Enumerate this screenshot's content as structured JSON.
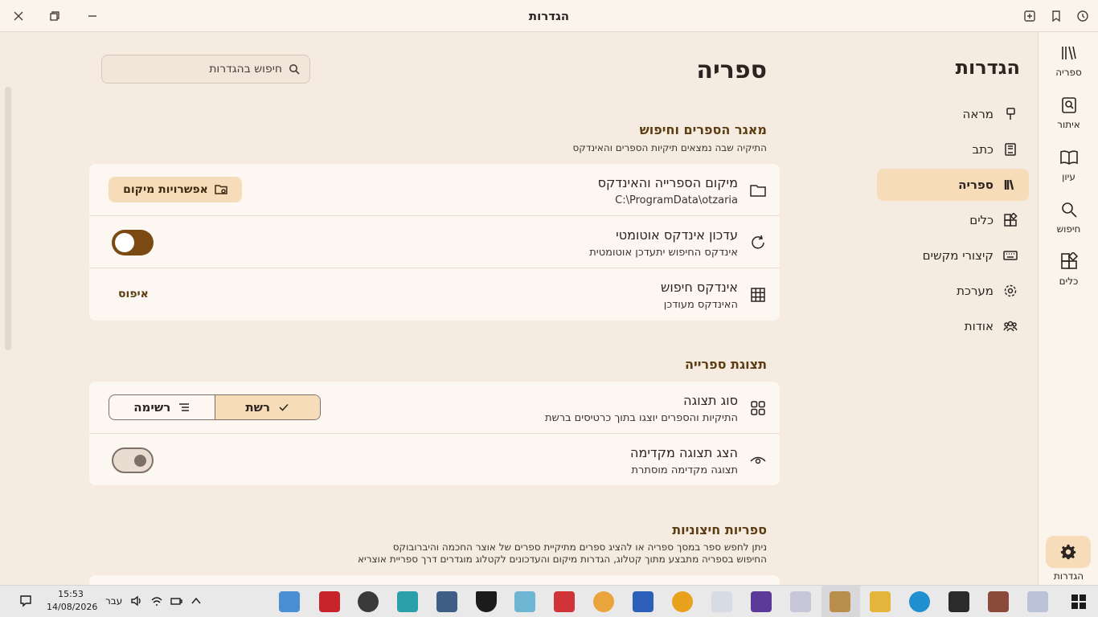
{
  "window": {
    "title": "הגדרות"
  },
  "rail": {
    "items": [
      {
        "label": "ספריה",
        "icon": "library-icon"
      },
      {
        "label": "איתור",
        "icon": "find-book-icon"
      },
      {
        "label": "עיון",
        "icon": "open-book-icon"
      },
      {
        "label": "חיפוש",
        "icon": "search-icon"
      },
      {
        "label": "כלים",
        "icon": "tools-icon"
      }
    ],
    "settings_label": "הגדרות"
  },
  "nav": {
    "title": "הגדרות",
    "items": [
      {
        "label": "מראה",
        "icon": "brush-icon"
      },
      {
        "label": "כתב",
        "icon": "text-doc-icon"
      },
      {
        "label": "ספריה",
        "icon": "library-icon",
        "active": true
      },
      {
        "label": "כלים",
        "icon": "tools-icon"
      },
      {
        "label": "קיצורי מקשים",
        "icon": "keyboard-icon"
      },
      {
        "label": "מערכת",
        "icon": "gear-icon"
      },
      {
        "label": "אודות",
        "icon": "people-icon"
      }
    ]
  },
  "main": {
    "title": "ספריה",
    "search_placeholder": "חיפוש בהגדרות",
    "sections": {
      "repo": {
        "title": "מאגר הספרים וחיפוש",
        "desc": "התיקיה שבה נמצאים תיקיות הספרים והאינדקס",
        "location": {
          "title": "מיקום הספרייה והאינדקס",
          "subtitle": "C:\\ProgramData\\otzaria",
          "button": "אפשרויות מיקום"
        },
        "auto_index": {
          "title": "עדכון אינדקס אוטומטי",
          "subtitle": "אינדקס החיפוש יתעדכן אוטומטית",
          "enabled": true
        },
        "search_index": {
          "title": "אינדקס חיפוש",
          "subtitle": "האינדקס מעודכן",
          "button": "איפוס"
        }
      },
      "display": {
        "title": "תצוגת ספרייה",
        "view_type": {
          "title": "סוג תצוגה",
          "subtitle": "התיקיות והספרים יוצגו בתוך כרטיסים ברשת",
          "options": [
            "רשימה",
            "רשת"
          ],
          "selected": "רשת"
        },
        "preview": {
          "title": "הצג תצוגה מקדימה",
          "subtitle": "תצוגה מקדימה מוסתרת",
          "enabled": false
        }
      },
      "external": {
        "title": "ספריות חיצוניות",
        "desc_line1": "ניתן לחפש ספר במסך ספריה או להציג ספרים מתיקיית ספרים של אוצר החכמה והיברובוקס",
        "desc_line2": "החיפוש בספריה מתבצע מתוך קטלוג, הגדרות מיקום והעדכונים לקטלוג מוגדרים דרך ספריית אוצריא"
      }
    }
  },
  "taskbar": {
    "time": "15:53",
    "date": "14/08/2026",
    "language": "עבר"
  }
}
